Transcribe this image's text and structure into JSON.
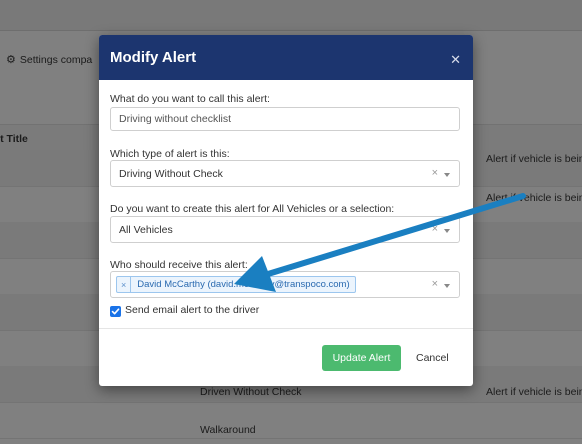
{
  "background": {
    "settings_link": "Settings compa",
    "table_header_title": "rt Title",
    "rows": [
      {
        "title": "",
        "description": "Alert if vehicle is bein"
      },
      {
        "title": "",
        "description": "Alert if vehicle is bein"
      },
      {
        "title": "Driven Without Check",
        "description": "Alert if vehicle is bein"
      },
      {
        "title": "Walkaround",
        "description": ""
      }
    ]
  },
  "modal": {
    "title": "Modify Alert",
    "close_icon": "close-icon",
    "alert_name": {
      "label": "What do you want to call this alert:",
      "value": "Driving without checklist"
    },
    "alert_type": {
      "label": "Which type of alert is this:",
      "value": "Driving Without Check"
    },
    "vehicles": {
      "label": "Do you want to create this alert for All Vehicles or a selection:",
      "value": "All Vehicles"
    },
    "recipients": {
      "label": "Who should receive this alert:",
      "tags": [
        {
          "remove": "×",
          "label": "David McCarthy (david.mccarthy@transpoco.com)"
        }
      ]
    },
    "send_driver_email": {
      "label": "Send email alert to the driver",
      "checked": true
    },
    "update_button": "Update Alert",
    "cancel_button": "Cancel"
  },
  "annotation": {
    "arrow_color": "#1a7fc1"
  },
  "colors": {
    "header": "#1c356f",
    "update_button": "#4cba6f",
    "checkbox": "#1a73e8"
  }
}
